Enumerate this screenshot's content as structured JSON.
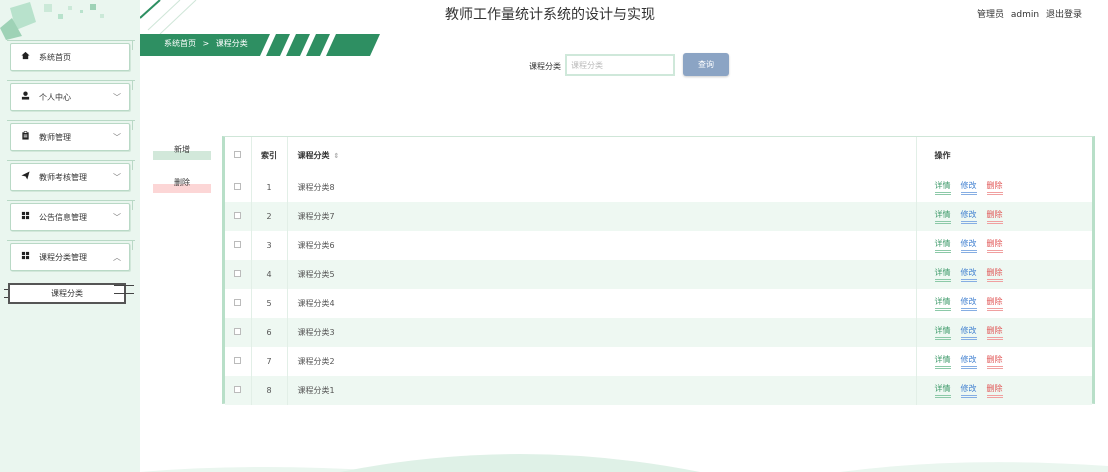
{
  "header": {
    "title": "教师工作量统计系统的设计与实现",
    "user_role": "管理员",
    "user_name": "admin",
    "logout_label": "退出登录"
  },
  "sidebar": {
    "items": [
      {
        "label": "系统首页",
        "icon": "home-icon",
        "arrow": ""
      },
      {
        "label": "个人中心",
        "icon": "user-icon",
        "arrow": "﹀"
      },
      {
        "label": "教师管理",
        "icon": "clipboard-icon",
        "arrow": "﹀"
      },
      {
        "label": "教师考核管理",
        "icon": "send-icon",
        "arrow": "﹀"
      },
      {
        "label": "公告信息管理",
        "icon": "grid-icon",
        "arrow": "﹀"
      },
      {
        "label": "课程分类管理",
        "icon": "grid-icon",
        "arrow": "︿"
      }
    ],
    "submenu": {
      "label": "课程分类"
    }
  },
  "breadcrumb": {
    "home": "系统首页",
    "separator": ">",
    "current": "课程分类"
  },
  "search": {
    "label": "课程分类",
    "placeholder": "课程分类",
    "button_label": "查询"
  },
  "actions": {
    "add_label": "新增",
    "delete_label": "删除"
  },
  "table": {
    "headers": {
      "index": "索引",
      "name": "课程分类",
      "sort_icon": "⇕",
      "actions": "操作"
    },
    "rows": [
      {
        "index": "1",
        "name": "课程分类8"
      },
      {
        "index": "2",
        "name": "课程分类7"
      },
      {
        "index": "3",
        "name": "课程分类6"
      },
      {
        "index": "4",
        "name": "课程分类5"
      },
      {
        "index": "5",
        "name": "课程分类4"
      },
      {
        "index": "6",
        "name": "课程分类3"
      },
      {
        "index": "7",
        "name": "课程分类2"
      },
      {
        "index": "8",
        "name": "课程分类1"
      }
    ],
    "row_actions": {
      "detail": "详情",
      "edit": "修改",
      "delete": "删除"
    }
  },
  "colors": {
    "sidebar_bg": "#eaf6ef",
    "accent_green": "#3e9a6a",
    "breadcrumb_bg": "#2e8f62",
    "search_button": "#8ba4c4",
    "edit_blue": "#3f7fd0",
    "delete_red": "#e05353"
  }
}
